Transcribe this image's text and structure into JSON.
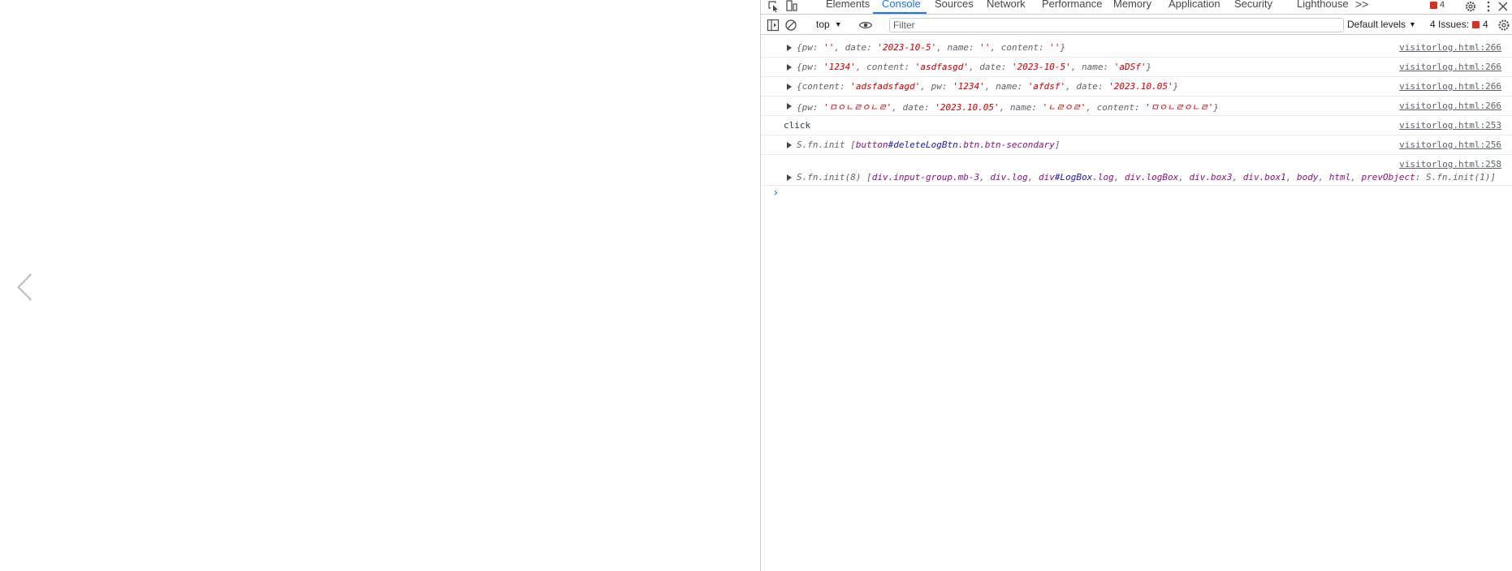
{
  "tabs": [
    "Elements",
    "Console",
    "Sources",
    "Network",
    "Performance",
    "Memory",
    "Application",
    "Security",
    "Lighthouse"
  ],
  "more_tabs": ">>",
  "error_badge_count": "4",
  "toolbar": {
    "context": "top",
    "filter_placeholder": "Filter",
    "levels": "Default levels",
    "issues_label": "4 Issues:",
    "issues_count": "4"
  },
  "logs": [
    {
      "kind": "object",
      "parts": [
        {
          "cls": "k",
          "text": "{pw: "
        },
        {
          "cls": "s",
          "text": "''"
        },
        {
          "cls": "k",
          "text": ", date: "
        },
        {
          "cls": "s",
          "text": "'2023-10-5'"
        },
        {
          "cls": "k",
          "text": ", name: "
        },
        {
          "cls": "s",
          "text": "''"
        },
        {
          "cls": "k",
          "text": ", content: "
        },
        {
          "cls": "s",
          "text": "''"
        },
        {
          "cls": "k",
          "text": "}"
        }
      ],
      "source": "visitorlog.html:266"
    },
    {
      "kind": "object",
      "parts": [
        {
          "cls": "k",
          "text": "{pw: "
        },
        {
          "cls": "s",
          "text": "'1234'"
        },
        {
          "cls": "k",
          "text": ", content: "
        },
        {
          "cls": "s",
          "text": "'asdfasgd'"
        },
        {
          "cls": "k",
          "text": ", date: "
        },
        {
          "cls": "s",
          "text": "'2023-10-5'"
        },
        {
          "cls": "k",
          "text": ", name: "
        },
        {
          "cls": "s",
          "text": "'aDSf'"
        },
        {
          "cls": "k",
          "text": "}"
        }
      ],
      "source": "visitorlog.html:266"
    },
    {
      "kind": "object",
      "parts": [
        {
          "cls": "k",
          "text": "{content: "
        },
        {
          "cls": "s",
          "text": "'adsfadsfagd'"
        },
        {
          "cls": "k",
          "text": ", pw: "
        },
        {
          "cls": "s",
          "text": "'1234'"
        },
        {
          "cls": "k",
          "text": ", name: "
        },
        {
          "cls": "s",
          "text": "'afdsf'"
        },
        {
          "cls": "k",
          "text": ", date: "
        },
        {
          "cls": "s",
          "text": "'2023.10.05'"
        },
        {
          "cls": "k",
          "text": "}"
        }
      ],
      "source": "visitorlog.html:266"
    },
    {
      "kind": "object",
      "parts": [
        {
          "cls": "k",
          "text": "{pw: "
        },
        {
          "cls": "s",
          "text": "'ㅁㅇㄴㄹㅇㄴㄹ'"
        },
        {
          "cls": "k",
          "text": ", date: "
        },
        {
          "cls": "s",
          "text": "'2023.10.05'"
        },
        {
          "cls": "k",
          "text": ", name: "
        },
        {
          "cls": "s",
          "text": "'ㄴㄹㅇㄹ'"
        },
        {
          "cls": "k",
          "text": ", content: "
        },
        {
          "cls": "s",
          "text": "'ㅁㅇㄴㄹㅇㄴㄹ'"
        },
        {
          "cls": "k",
          "text": "}"
        }
      ],
      "source": "visitorlog.html:266"
    },
    {
      "kind": "plain",
      "parts": [
        {
          "cls": "",
          "text": "click"
        }
      ],
      "source": "visitorlog.html:253"
    },
    {
      "kind": "object",
      "parts": [
        {
          "cls": "k",
          "text": "S.fn.init ["
        },
        {
          "cls": "t",
          "text": "button"
        },
        {
          "cls": "id",
          "text": "#deleteLogBtn"
        },
        {
          "cls": "t",
          "text": ".btn.btn-secondary"
        },
        {
          "cls": "k",
          "text": "]"
        }
      ],
      "source": "visitorlog.html:256"
    },
    {
      "kind": "object-tall",
      "parts": [
        {
          "cls": "k",
          "text": "S.fn.init(8) ["
        },
        {
          "cls": "t",
          "text": "div.input-group.mb-3"
        },
        {
          "cls": "k",
          "text": ", "
        },
        {
          "cls": "t",
          "text": "div.log"
        },
        {
          "cls": "k",
          "text": ", "
        },
        {
          "cls": "t",
          "text": "div"
        },
        {
          "cls": "id",
          "text": "#LogBox"
        },
        {
          "cls": "t",
          "text": ".log"
        },
        {
          "cls": "k",
          "text": ", "
        },
        {
          "cls": "t",
          "text": "div.logBox"
        },
        {
          "cls": "k",
          "text": ", "
        },
        {
          "cls": "t",
          "text": "div.box3"
        },
        {
          "cls": "k",
          "text": ", "
        },
        {
          "cls": "t",
          "text": "div.box1"
        },
        {
          "cls": "k",
          "text": ", "
        },
        {
          "cls": "t",
          "text": "body"
        },
        {
          "cls": "k",
          "text": ", "
        },
        {
          "cls": "t",
          "text": "html"
        },
        {
          "cls": "k",
          "text": ", "
        },
        {
          "cls": "t",
          "text": "prevObject"
        },
        {
          "cls": "k",
          "text": ": S.fn.init(1)]"
        }
      ],
      "source": "visitorlog.html:258"
    }
  ],
  "prompt": "›"
}
